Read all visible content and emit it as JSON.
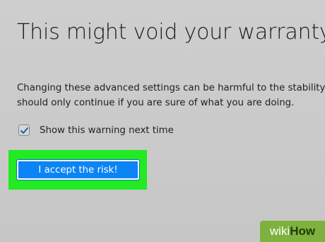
{
  "page": {
    "title": "This might void your warranty!",
    "description_line1": "Changing these advanced settings can be harmful to the stability, s",
    "description_line2": "should only continue if you are sure of what you are doing."
  },
  "warning_checkbox": {
    "label": "Show this warning next time",
    "checked": true
  },
  "accept_button": {
    "label": "I accept the risk!",
    "highlighted": true
  },
  "watermark": {
    "brand_prefix": "wiki",
    "brand_suffix": "How"
  },
  "colors": {
    "background": "#cbcbcb",
    "button": "#0b84f5",
    "highlight": "#22ea23",
    "watermark": "#7eb13d"
  }
}
